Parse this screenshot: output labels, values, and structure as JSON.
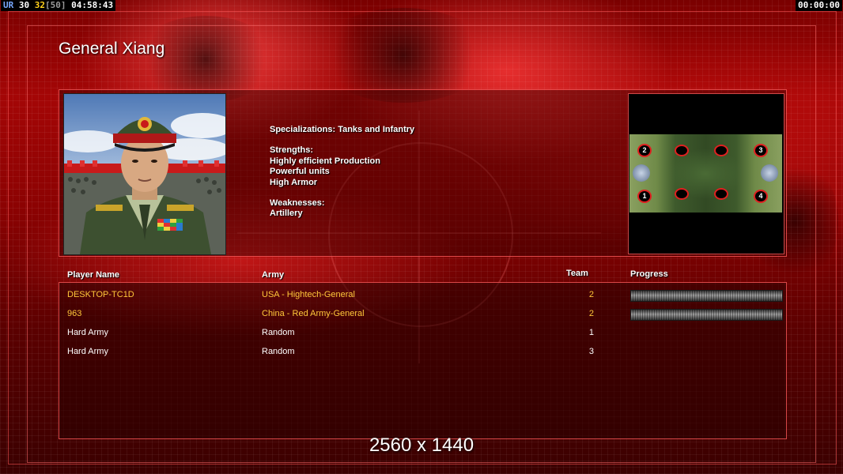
{
  "hud": {
    "label": "UR",
    "v1": "30",
    "v2": "32",
    "v3": "[50]",
    "time": "04:58:43",
    "clock": "00:00:00"
  },
  "general": {
    "name": "General Xiang",
    "specializations": "Specializations: Tanks and Infantry",
    "strengths_title": "Strengths:",
    "strengths": [
      "Highly efficient Production",
      "Powerful units",
      "High Armor"
    ],
    "weaknesses_title": "Weaknesses:",
    "weaknesses": [
      "Artillery"
    ]
  },
  "minimap": {
    "start_positions": [
      "1",
      "2",
      "3",
      "4"
    ]
  },
  "table": {
    "headers": {
      "name": "Player Name",
      "army": "Army",
      "team": "Team",
      "progress": "Progress"
    },
    "rows": [
      {
        "name": "DESKTOP-TC1D",
        "army": "USA - Hightech-General",
        "team": "2",
        "human": true,
        "progress": 1.0
      },
      {
        "name": "963",
        "army": "China - Red Army-General",
        "team": "2",
        "human": true,
        "progress": 1.0
      },
      {
        "name": "Hard Army",
        "army": "Random",
        "team": "1",
        "human": false
      },
      {
        "name": "Hard Army",
        "army": "Random",
        "team": "3",
        "human": false
      }
    ]
  },
  "resolution": "2560 x 1440",
  "colors": {
    "human_text": "#ffc83a",
    "ai_text": "#ffffff",
    "frame": "#ff5a5a",
    "start_marker": "#e02020"
  }
}
